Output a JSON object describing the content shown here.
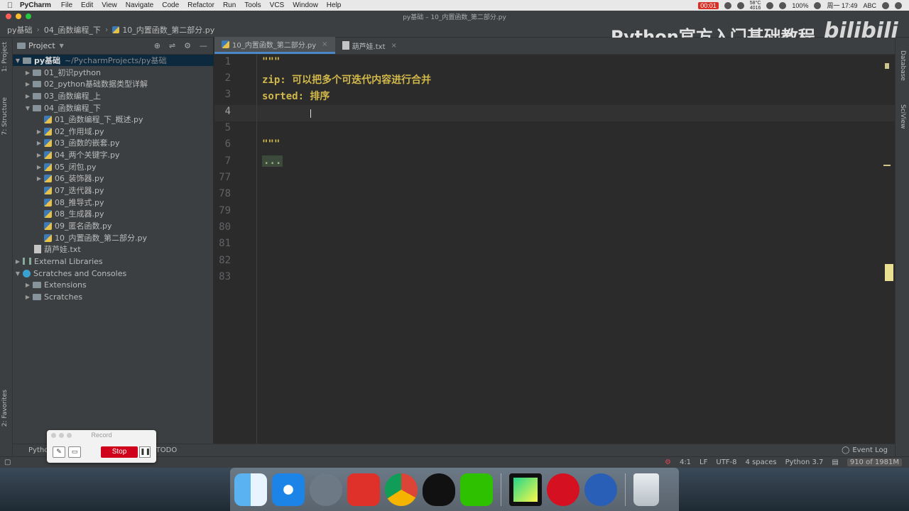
{
  "menubar": {
    "app": "PyCharm",
    "items": [
      "File",
      "Edit",
      "View",
      "Navigate",
      "Code",
      "Refactor",
      "Run",
      "Tools",
      "VCS",
      "Window",
      "Help"
    ],
    "rec_time": "00:01",
    "temp": "58°C",
    "rpm": "4016",
    "battery": "100%",
    "input": "ABC",
    "clock": "周一 17:49"
  },
  "window": {
    "title": "py基础 – 10_内置函数_第二部分.py"
  },
  "navbar": {
    "crumbs": [
      "py基础",
      "04_函数编程_下",
      "10_内置函数_第二部分.py"
    ]
  },
  "watermark": {
    "text": "Python官方入门基础教程",
    "logo": "bilibili"
  },
  "left_strip": {
    "project": "1: Project",
    "structure": "7: Structure",
    "favorites": "2: Favorites"
  },
  "project": {
    "title": "Project",
    "root": "py基础",
    "root_path": "~/PycharmProjects/py基础",
    "tree": [
      {
        "label": "01_初识python",
        "type": "folder"
      },
      {
        "label": "02_python基础数据类型详解",
        "type": "folder"
      },
      {
        "label": "03_函数编程_上",
        "type": "folder"
      },
      {
        "label": "04_函数编程_下",
        "type": "folder"
      },
      {
        "label": "01_函数编程_下_概述.py",
        "type": "py"
      },
      {
        "label": "02_作用域.py",
        "type": "py"
      },
      {
        "label": "03_函数的嵌套.py",
        "type": "py"
      },
      {
        "label": "04_两个关键字.py",
        "type": "py"
      },
      {
        "label": "05_闭包.py",
        "type": "py"
      },
      {
        "label": "06_装饰器.py",
        "type": "py"
      },
      {
        "label": "07_迭代器.py",
        "type": "py"
      },
      {
        "label": "08_推导式.py",
        "type": "py"
      },
      {
        "label": "08_生成器.py",
        "type": "py"
      },
      {
        "label": "09_匿名函数.py",
        "type": "py"
      },
      {
        "label": "10_内置函数_第二部分.py",
        "type": "py"
      },
      {
        "label": "葫芦娃.txt",
        "type": "txt"
      },
      {
        "label": "External Libraries",
        "type": "lib"
      },
      {
        "label": "Scratches and Consoles",
        "type": "scratch"
      },
      {
        "label": "Extensions",
        "type": "folder"
      },
      {
        "label": "Scratches",
        "type": "folder"
      }
    ]
  },
  "editor": {
    "tabs": [
      "10_内置函数_第二部分.py",
      "葫芦娃.txt"
    ],
    "line_numbers": [
      "1",
      "2",
      "3",
      "4",
      "5",
      "6",
      "7",
      "77",
      "78",
      "79",
      "80",
      "81",
      "82",
      "83"
    ],
    "lines": [
      "\"\"\"",
      "zip: 可以把多个可迭代内容进行合并",
      "sorted: 排序",
      "",
      "",
      "\"\"\"",
      "..."
    ]
  },
  "right_strip": {
    "database": "Database",
    "sciview": "SciView"
  },
  "bottombar": {
    "python_console": "Python",
    "todo": "TODO",
    "event_log": "Event Log"
  },
  "statusbar": {
    "position": "4:1",
    "line_sep": "LF",
    "encoding": "UTF-8",
    "indent": "4 spaces",
    "interpreter": "Python 3.7",
    "memory": "910 of 1981M"
  },
  "record": {
    "title": "Record",
    "stop": "Stop"
  }
}
